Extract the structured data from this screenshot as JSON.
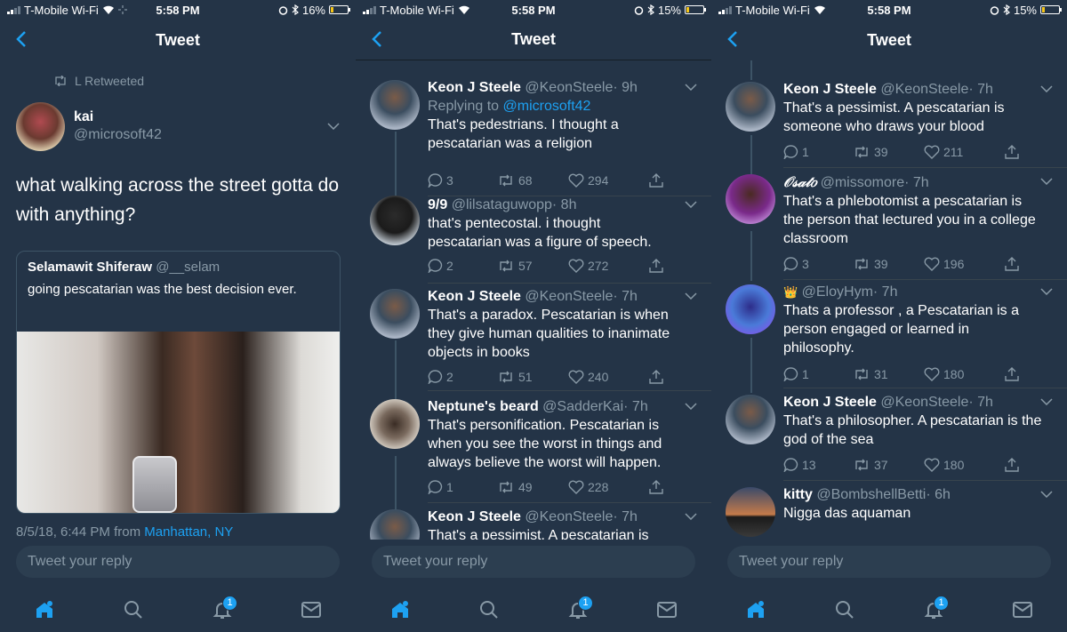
{
  "colors": {
    "background": "#243447",
    "accent": "#1da1f2",
    "secondary_text": "#8899a6",
    "battery": "#f5c518"
  },
  "screens": [
    {
      "status": {
        "carrier": "T-Mobile Wi-Fi",
        "time": "5:58 PM",
        "battery": "16%",
        "battery_level": 0.16
      },
      "nav": {
        "title": "Tweet"
      },
      "retweet_label": "L Retweeted",
      "author": {
        "name": "kai",
        "handle": "@microsoft42"
      },
      "text": "what walking across the street gotta do with anything?",
      "quote": {
        "name": "Selamawit Shiferaw",
        "handle": "@__selam",
        "text": "going pescatarian was the best decision ever."
      },
      "timestamp": {
        "text": "8/5/18, 6:44 PM from",
        "place": "Manhattan, NY"
      },
      "reply_placeholder": "Tweet your reply",
      "tabs": {
        "notifications_badge": "1"
      }
    },
    {
      "status": {
        "carrier": "T-Mobile Wi-Fi",
        "time": "5:58 PM",
        "battery": "15%",
        "battery_level": 0.15
      },
      "nav": {
        "title": "Tweet"
      },
      "replies": [
        {
          "name": "Keon J Steele",
          "handle": "@KeonSteele",
          "time": "· 9h",
          "replying_label": "Replying to",
          "replying_to": "@microsoft42",
          "text": "That's pedestrians. I thought a pescatarian was a religion",
          "comments": "3",
          "retweets": "68",
          "likes": "294"
        },
        {
          "name": "9/9",
          "handle": "@lilsataguwopp",
          "time": "· 8h",
          "text": "that's pentecostal. i thought pescatarian was a figure of speech.",
          "comments": "2",
          "retweets": "57",
          "likes": "272"
        },
        {
          "name": "Keon J Steele",
          "handle": "@KeonSteele",
          "time": "· 7h",
          "text": "That's a paradox. Pescatarian is when they give human qualities to inanimate objects in books",
          "comments": "2",
          "retweets": "51",
          "likes": "240"
        },
        {
          "name": "Neptune's beard",
          "handle": "@SadderKai",
          "time": "· 7h",
          "text": "That's personification. Pescatarian is when you see the worst in things and always believe the worst will happen.",
          "comments": "1",
          "retweets": "49",
          "likes": "228"
        },
        {
          "name": "Keon J Steele",
          "handle": "@KeonSteele",
          "time": "· 7h",
          "text": "That's a pessimist. A pescatarian is"
        }
      ],
      "reply_placeholder": "Tweet your reply",
      "tabs": {
        "notifications_badge": "1"
      }
    },
    {
      "status": {
        "carrier": "T-Mobile Wi-Fi",
        "time": "5:58 PM",
        "battery": "15%",
        "battery_level": 0.15
      },
      "nav": {
        "title": "Tweet"
      },
      "replies": [
        {
          "name": "Keon J Steele",
          "handle": "@KeonSteele",
          "time": "· 7h",
          "text": "That's a pessimist. A pescatarian is someone who draws your blood",
          "comments": "1",
          "retweets": "39",
          "likes": "211"
        },
        {
          "name": "𝒪𝓈𝒶𝓉𝑜",
          "handle": "@missomore",
          "time": "· 7h",
          "text": "That's a phlebotomist a pescatarian is the person that lectured you in a college classroom",
          "comments": "3",
          "retweets": "39",
          "likes": "196"
        },
        {
          "name": "👑",
          "handle": "@EloyHym",
          "time": "· 7h",
          "text": "Thats a professor , a Pescatarian is a person engaged or learned in philosophy.",
          "comments": "1",
          "retweets": "31",
          "likes": "180"
        },
        {
          "name": "Keon J Steele",
          "handle": "@KeonSteele",
          "time": "· 7h",
          "text": "That's a philosopher. A pescatarian is the god of the sea",
          "comments": "13",
          "retweets": "37",
          "likes": "180"
        },
        {
          "name": "kitty",
          "handle": "@BombshellBetti",
          "time": "· 6h",
          "text": "Nigga das aquaman"
        }
      ],
      "reply_placeholder": "Tweet your reply",
      "tabs": {
        "notifications_badge": "1"
      }
    }
  ]
}
